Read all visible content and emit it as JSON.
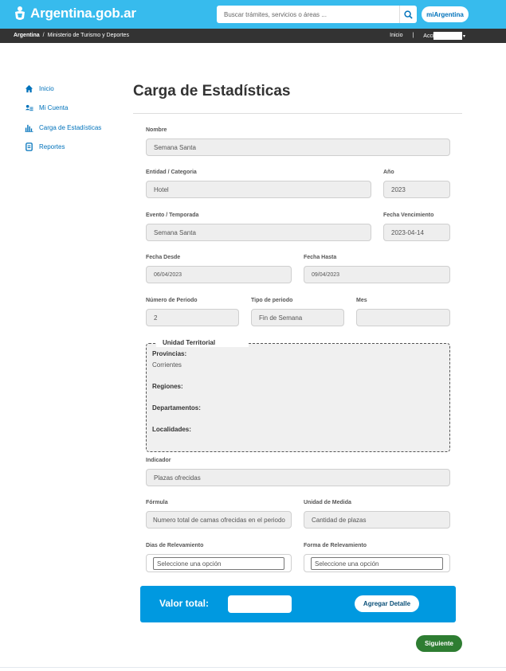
{
  "header": {
    "logo_text": "Argentina.gob.ar",
    "search_placeholder": "Buscar trámites, servicios o áreas ...",
    "account_button": "miArgentina"
  },
  "breadcrumb": {
    "root": "Argentina",
    "separator": "/",
    "current": "Ministerio de Turismo y Deportes"
  },
  "subnav": {
    "home": "Inicio",
    "divider": "|",
    "actions": "Acciones ▾",
    "user_caret": "▾"
  },
  "sidebar": {
    "items": [
      {
        "label": "Inicio",
        "icon": "home-icon"
      },
      {
        "label": "Mi Cuenta",
        "icon": "user-card-icon"
      },
      {
        "label": "Carga de Estadísticas",
        "icon": "bar-chart-icon"
      },
      {
        "label": "Reportes",
        "icon": "report-icon"
      }
    ]
  },
  "page": {
    "title": "Carga de Estadísticas"
  },
  "form": {
    "nombre": {
      "label": "Nombre",
      "value": "Semana Santa"
    },
    "entidad": {
      "label": "Entidad / Categoria",
      "value": "Hotel"
    },
    "anio": {
      "label": "Año",
      "value": "2023"
    },
    "evento": {
      "label": "Evento / Temporada",
      "value": "Semana Santa"
    },
    "vencimiento": {
      "label": "Fecha Vencimiento",
      "value": "2023-04-14"
    },
    "fecha_desde": {
      "label": "Fecha Desde",
      "value": "06/04/2023"
    },
    "fecha_hasta": {
      "label": "Fecha Hasta",
      "value": "09/04/2023"
    },
    "numero_periodo": {
      "label": "Número de Periodo",
      "value": "2"
    },
    "tipo_periodo": {
      "label": "Tipo de periodo",
      "value": "Fin de Semana"
    },
    "mes": {
      "label": "Mes",
      "value": ""
    },
    "unidad_territorial": {
      "legend": "Unidad Territorial",
      "provincias_label": "Provincias:",
      "provincias_value": "Corrientes",
      "regiones_label": "Regiones:",
      "departamentos_label": "Departamentos:",
      "localidades_label": "Localidades:"
    },
    "indicador": {
      "label": "Indicador",
      "value": "Plazas ofrecidas"
    },
    "formula": {
      "label": "Fórmula",
      "value": "Numero total de camas ofrecidas en el periodo"
    },
    "unidad_medida": {
      "label": "Unidad de Medida",
      "value": "Cantidad de plazas"
    },
    "dias_relevamiento": {
      "label": "Dias de Relevamiento",
      "placeholder": "Seleccione una opción"
    },
    "forma_relevamiento": {
      "label": "Forma de Relevamiento",
      "placeholder": "Seleccione una opción"
    }
  },
  "total": {
    "label": "Valor total:",
    "value": "",
    "add_button": "Agregar Detalle"
  },
  "next_button": "Siguiente",
  "colors": {
    "topbar": "#37bbed",
    "subbar": "#333333",
    "link": "#0072bb",
    "total_bar": "#0099e0",
    "next_button": "#2e7d32"
  }
}
